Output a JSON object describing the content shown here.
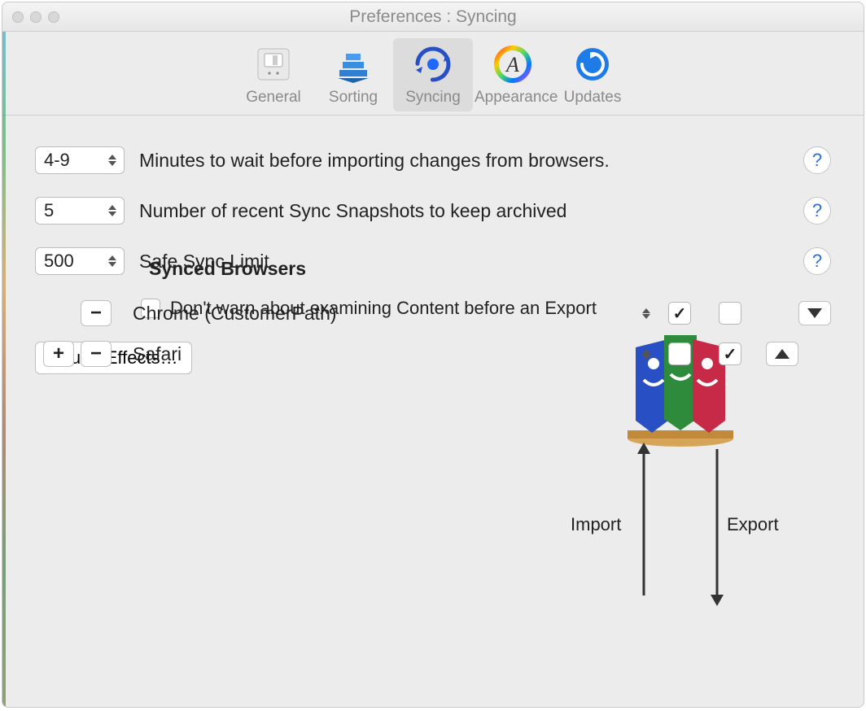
{
  "window": {
    "title": "Preferences : Syncing"
  },
  "toolbar": {
    "items": [
      {
        "label": "General"
      },
      {
        "label": "Sorting"
      },
      {
        "label": "Syncing",
        "active": true
      },
      {
        "label": "Appearance"
      },
      {
        "label": "Updates"
      }
    ]
  },
  "settings": {
    "minutes_value": "4-9",
    "minutes_label": "Minutes to wait before importing changes from browsers.",
    "snapshots_value": "5",
    "snapshots_label": "Number of recent Sync Snapshots to keep archived",
    "limit_value": "500",
    "limit_label": "Safe Sync Limit",
    "dont_warn_label": "Don't warn about examining Content before an Export",
    "dont_warn_checked": false,
    "sound_effects_button": "Sound Effects…",
    "help_glyph": "?"
  },
  "sync": {
    "import_label": "Import",
    "export_label": "Export",
    "title": "Synced Browsers",
    "browsers": [
      {
        "name": "Chrome (CustomerPath)",
        "import": true,
        "export": false,
        "can_add": false,
        "expanded": false
      },
      {
        "name": "Safari",
        "import": false,
        "export": true,
        "can_add": true,
        "expanded": true
      }
    ],
    "plus_glyph": "+",
    "minus_glyph": "−"
  }
}
